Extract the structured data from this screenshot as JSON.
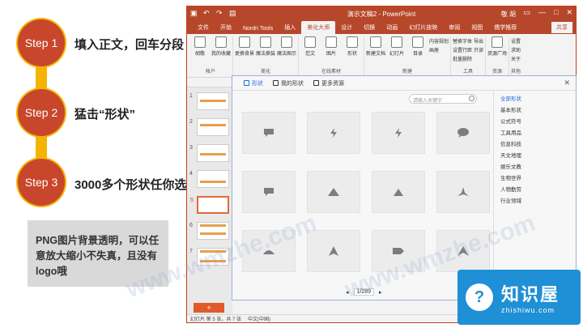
{
  "steps": [
    {
      "badge": "Step 1",
      "text": "填入正文，回车分段"
    },
    {
      "badge": "Step 2",
      "text": "猛击“形状”"
    },
    {
      "badge": "Step 3",
      "text": "3000多个形状任你选"
    }
  ],
  "note": "PNG图片背景透明，可以任意放大缩小不失真，且没有logo哦",
  "window": {
    "title": "演示文稿2 - PowerPoint",
    "user": "敬 胡",
    "tabs": [
      "文件",
      "开始",
      "Nordri Tools",
      "插入",
      "美化大师",
      "设计",
      "切换",
      "动画",
      "幻灯片放映",
      "审阅",
      "视图",
      "儒学推荐"
    ],
    "active_tab": "美化大师",
    "share": "共享"
  },
  "ribbon": {
    "groups": [
      {
        "label": "帐户",
        "buttons": [
          "胡敬",
          "我的收藏"
        ]
      },
      {
        "label": "美化",
        "buttons": [
          "更换背景",
          "魔法换装",
          "魔法图示"
        ]
      },
      {
        "label": "在线素材",
        "buttons": [
          "范文",
          "图片",
          "形状"
        ]
      },
      {
        "label": "新建",
        "buttons": [
          "新建文档",
          "幻灯片",
          "目录"
        ]
      }
    ],
    "list1": [
      "内容规划",
      "画册"
    ],
    "list2": [
      "替换字体",
      "设置行距",
      "批量删除"
    ],
    "list3": [
      "导出",
      "只读"
    ],
    "tools_label": "工具",
    "resource": {
      "label": "资源",
      "button": "资源广场"
    },
    "others": {
      "label": "其他",
      "items": [
        "设置",
        "求助",
        "关于"
      ]
    }
  },
  "slides": [
    "1",
    "2",
    "3",
    "4",
    "5",
    "6",
    "7"
  ],
  "status": {
    "left": "幻灯片 第 5 张，共 7 张",
    "lang": "中文(中国)",
    "notes": "备注",
    "comments": "批注"
  },
  "dialog": {
    "tabs": [
      "形状",
      "我的形状",
      "更多资源"
    ],
    "search_placeholder": "请输入关键字",
    "categories": [
      "全部形状",
      "基本形状",
      "公式符号",
      "工具用品",
      "信息科技",
      "天文地理",
      "娱乐文教",
      "生物世界",
      "人物勤劳",
      "行业领域"
    ],
    "active_category": "全部形状",
    "page": "1/289",
    "shapes": [
      "speech-rect-icon",
      "bolt-icon",
      "bolt-icon",
      "speech-oval-icon",
      "speech-rect-icon",
      "triangle-icon",
      "triangle-small-icon",
      "star-arrow-icon",
      "mound-icon",
      "arrowhead-icon",
      "tag-icon",
      "chevron-up-icon"
    ]
  },
  "watermark": "www.wmzhe.com",
  "logo": {
    "cn": "知识屋",
    "en": "zhishiwu.com"
  },
  "colors": {
    "step": "#c8462b",
    "line": "#f5b301",
    "ppt": "#b7472a",
    "accent": "#1e6fd9",
    "logo": "#1f8fd6"
  }
}
